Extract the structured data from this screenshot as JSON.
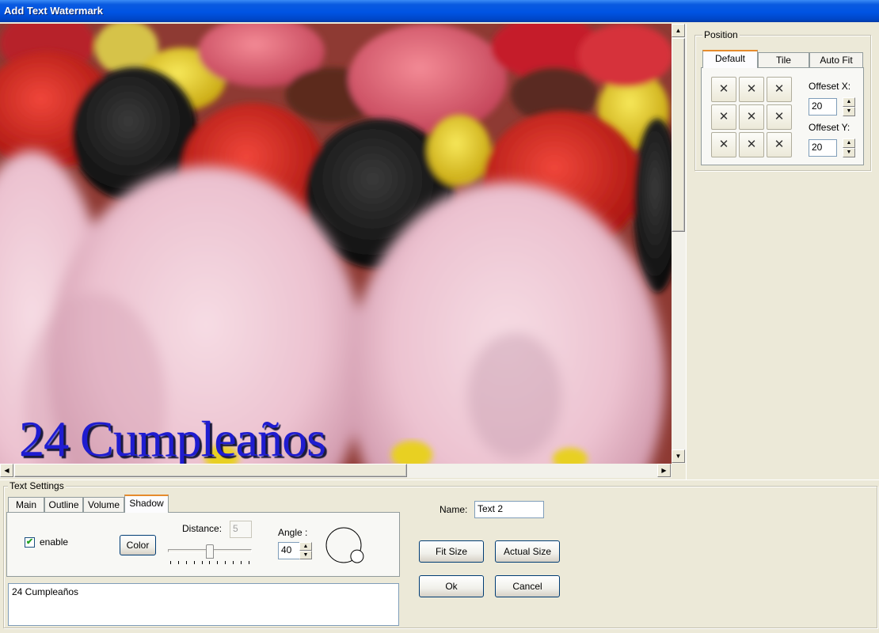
{
  "window": {
    "title": "Add Text Watermark"
  },
  "preview": {
    "watermark_text": "24 Cumpleaños",
    "watermark_color": "#1f1cd0",
    "vscroll_position": 0.45,
    "hscroll_position": 0.0
  },
  "position": {
    "group_label": "Position",
    "tabs": [
      {
        "label": "Default",
        "active": true
      },
      {
        "label": "Tile",
        "active": false
      },
      {
        "label": "Auto Fit",
        "active": false
      }
    ],
    "grid_glyph": "✕",
    "offset_x_label": "Offeset X:",
    "offset_x_value": "20",
    "offset_y_label": "Offeset Y:",
    "offset_y_value": "20"
  },
  "text_settings": {
    "group_label": "Text Settings",
    "tabs": [
      {
        "label": "Main",
        "active": false
      },
      {
        "label": "Outline",
        "active": false
      },
      {
        "label": "Volume",
        "active": false
      },
      {
        "label": "Shadow",
        "active": true
      }
    ],
    "enable_label": "enable",
    "enable_checked": true,
    "color_button": "Color",
    "distance_label": "Distance:",
    "distance_value": "5",
    "distance_slider_fraction": 0.5,
    "angle_label": "Angle :",
    "angle_value": "40",
    "text_content": "24 Cumpleaños"
  },
  "right_panel": {
    "name_label": "Name:",
    "name_value": "Text 2",
    "fit_size_button": "Fit Size",
    "actual_size_button": "Actual Size",
    "ok_button": "Ok",
    "cancel_button": "Cancel"
  },
  "glyphs": {
    "up": "▲",
    "down": "▼",
    "left": "◀",
    "right": "▶",
    "check": "✔"
  }
}
